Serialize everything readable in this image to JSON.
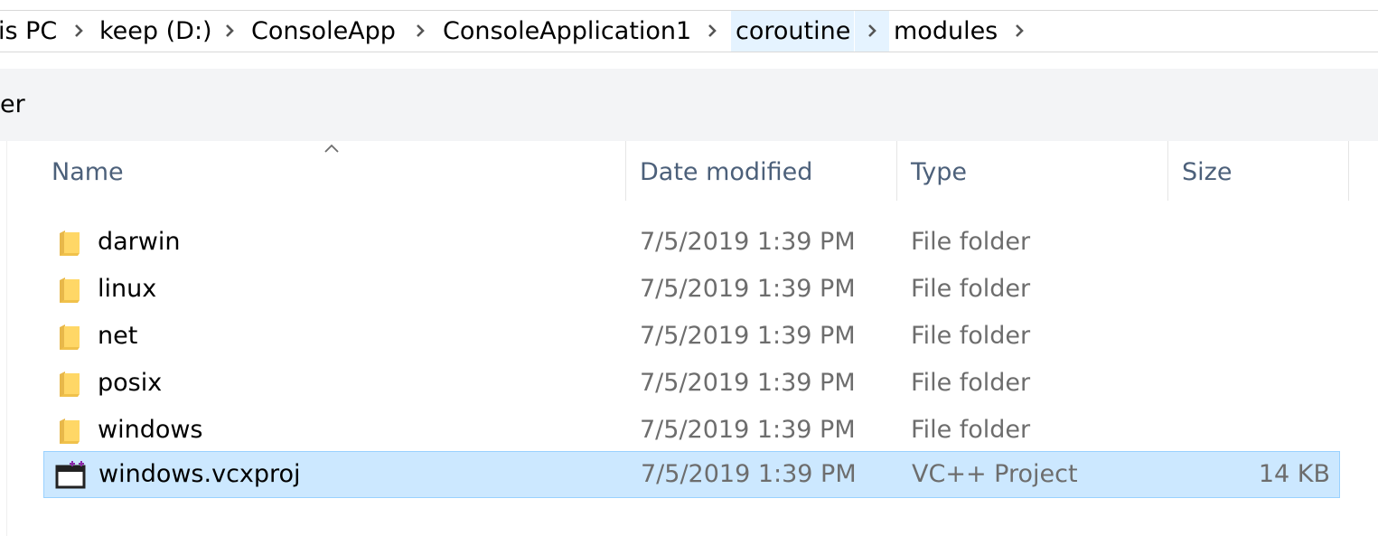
{
  "breadcrumb": {
    "items": [
      "is PC",
      "keep (D:)",
      "ConsoleApp",
      "ConsoleApplication1",
      "coroutine",
      "modules"
    ]
  },
  "commandbar": {
    "partial_text": "er"
  },
  "columns": {
    "name": "Name",
    "date": "Date modified",
    "type": "Type",
    "size": "Size"
  },
  "files": [
    {
      "name": "darwin",
      "date": "7/5/2019 1:39 PM",
      "type": "File folder",
      "size": "",
      "icon": "folder-icon",
      "selected": false
    },
    {
      "name": "linux",
      "date": "7/5/2019 1:39 PM",
      "type": "File folder",
      "size": "",
      "icon": "folder-icon",
      "selected": false
    },
    {
      "name": "net",
      "date": "7/5/2019 1:39 PM",
      "type": "File folder",
      "size": "",
      "icon": "folder-icon",
      "selected": false
    },
    {
      "name": "posix",
      "date": "7/5/2019 1:39 PM",
      "type": "File folder",
      "size": "",
      "icon": "folder-icon",
      "selected": false
    },
    {
      "name": "windows",
      "date": "7/5/2019 1:39 PM",
      "type": "File folder",
      "size": "",
      "icon": "folder-icon",
      "selected": false
    },
    {
      "name": "windows.vcxproj",
      "date": "7/5/2019 1:39 PM",
      "type": "VC++ Project",
      "size": "14 KB",
      "icon": "vcxproj-file-icon",
      "selected": true
    }
  ],
  "colors": {
    "selection_bg": "#cce8ff",
    "selection_border": "#99d1ff",
    "header_text": "#4c607a",
    "active_crumb_bg": "#e5f3ff",
    "folder_yellow": "#ffd766"
  }
}
